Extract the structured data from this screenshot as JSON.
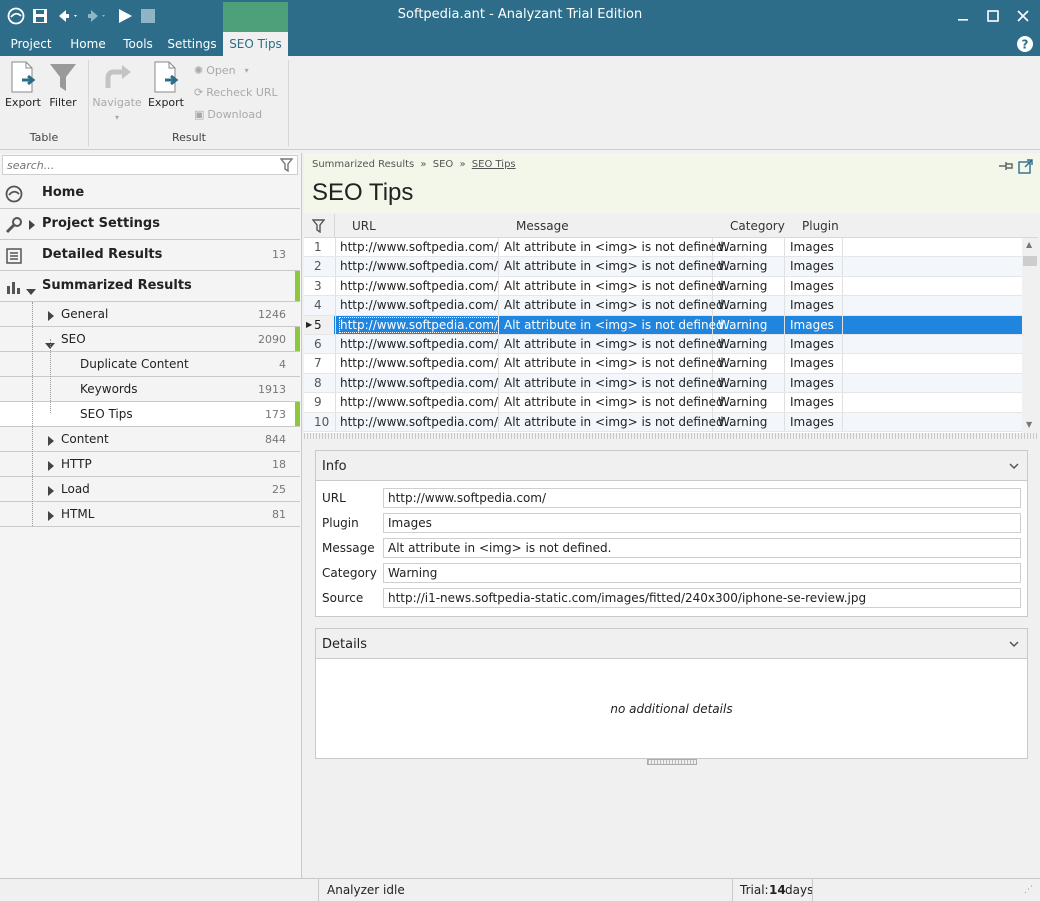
{
  "window": {
    "title": "Softpedia.ant - Analyzant Trial Edition"
  },
  "menu": [
    "Project",
    "Home",
    "Tools",
    "Settings",
    "SEO Tips"
  ],
  "ribbon": {
    "table_group": {
      "label": "Table",
      "export": "Export",
      "filter": "Filter"
    },
    "result_group": {
      "label": "Result",
      "navigate": "Navigate",
      "export": "Export",
      "open": "Open",
      "recheck": "Recheck URL",
      "download": "Download"
    }
  },
  "left": {
    "search_placeholder": "search...",
    "home": "Home",
    "project_settings": "Project Settings",
    "detailed_results": {
      "label": "Detailed Results",
      "count": "13"
    },
    "summarized_results": "Summarized Results",
    "general": {
      "label": "General",
      "count": "1246"
    },
    "seo": {
      "label": "SEO",
      "count": "2090"
    },
    "duplicate": {
      "label": "Duplicate Content",
      "count": "4"
    },
    "keywords": {
      "label": "Keywords",
      "count": "1913"
    },
    "seo_tips": {
      "label": "SEO Tips",
      "count": "173"
    },
    "content": {
      "label": "Content",
      "count": "844"
    },
    "http": {
      "label": "HTTP",
      "count": "18"
    },
    "load": {
      "label": "Load",
      "count": "25"
    },
    "html": {
      "label": "HTML",
      "count": "81"
    }
  },
  "breadcrumb": {
    "part1": "Summarized Results",
    "sep": "»",
    "part2": "SEO",
    "part3": "SEO Tips",
    "title": "SEO Tips"
  },
  "grid": {
    "headers": {
      "url": "URL",
      "message": "Message",
      "category": "Category",
      "plugin": "Plugin"
    },
    "rows": [
      {
        "n": "1",
        "url": "http://www.softpedia.com/",
        "message": "Alt attribute in <img> is not defined.",
        "category": "Warning",
        "plugin": "Images"
      },
      {
        "n": "2",
        "url": "http://www.softpedia.com/",
        "message": "Alt attribute in <img> is not defined.",
        "category": "Warning",
        "plugin": "Images"
      },
      {
        "n": "3",
        "url": "http://www.softpedia.com/",
        "message": "Alt attribute in <img> is not defined.",
        "category": "Warning",
        "plugin": "Images"
      },
      {
        "n": "4",
        "url": "http://www.softpedia.com/",
        "message": "Alt attribute in <img> is not defined.",
        "category": "Warning",
        "plugin": "Images"
      },
      {
        "n": "5",
        "url": "http://www.softpedia.com/",
        "message": "Alt attribute in <img> is not defined.",
        "category": "Warning",
        "plugin": "Images"
      },
      {
        "n": "6",
        "url": "http://www.softpedia.com/",
        "message": "Alt attribute in <img> is not defined.",
        "category": "Warning",
        "plugin": "Images"
      },
      {
        "n": "7",
        "url": "http://www.softpedia.com/",
        "message": "Alt attribute in <img> is not defined.",
        "category": "Warning",
        "plugin": "Images"
      },
      {
        "n": "8",
        "url": "http://www.softpedia.com/",
        "message": "Alt attribute in <img> is not defined.",
        "category": "Warning",
        "plugin": "Images"
      },
      {
        "n": "9",
        "url": "http://www.softpedia.com/",
        "message": "Alt attribute in <img> is not defined.",
        "category": "Warning",
        "plugin": "Images"
      },
      {
        "n": "10",
        "url": "http://www.softpedia.com/",
        "message": "Alt attribute in <img> is not defined.",
        "category": "Warning",
        "plugin": "Images"
      }
    ],
    "selected_row": 5
  },
  "info": {
    "title": "Info",
    "url_label": "URL",
    "url": "http://www.softpedia.com/",
    "plugin_label": "Plugin",
    "plugin": "Images",
    "message_label": "Message",
    "message": "Alt attribute in <img> is not defined.",
    "category_label": "Category",
    "category": "Warning",
    "source_label": "Source",
    "source": "http://i1-news.softpedia-static.com/images/fitted/240x300/iphone-se-review.jpg"
  },
  "details": {
    "title": "Details",
    "empty": "no additional details"
  },
  "status": {
    "left": "Analyzer idle",
    "trial_label": "Trial:",
    "trial_value": "14",
    "trial_unit": "days"
  },
  "colors": {
    "accent": "#2d6d8a",
    "selection": "#1f85de",
    "green": "#8dc63f"
  }
}
